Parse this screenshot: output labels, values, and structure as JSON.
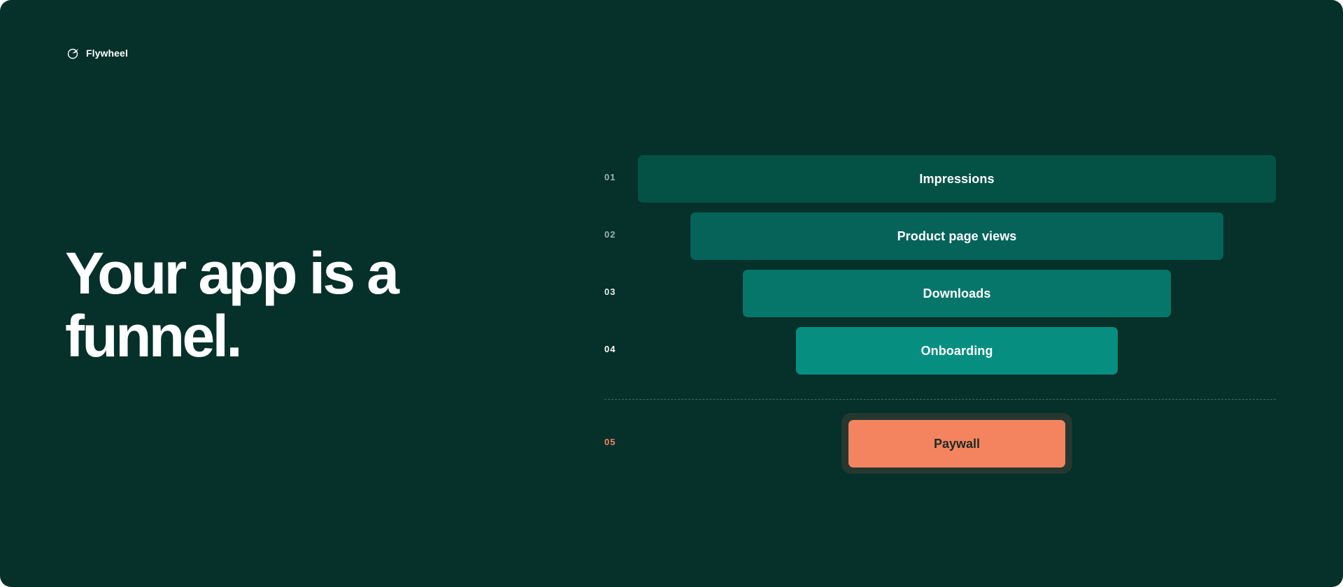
{
  "brand": {
    "name": "Flywheel",
    "icon": "flywheel-logo-icon"
  },
  "headline": {
    "line1": "Your app is a",
    "line2": "funnel."
  },
  "colors": {
    "background": "#06302a",
    "text": "#ffffff",
    "paywall": "#f4845f",
    "paywall_ring": "#25382f"
  },
  "funnel": {
    "steps": [
      {
        "number": "01",
        "label": "Impressions",
        "color": "#045246",
        "number_color": "#9bb5ae"
      },
      {
        "number": "02",
        "label": "Product page views",
        "color": "#05635a",
        "number_color": "#9bb5ae"
      },
      {
        "number": "03",
        "label": "Downloads",
        "color": "#07766a",
        "number_color": "#e6efec"
      },
      {
        "number": "04",
        "label": "Onboarding",
        "color": "#068f80",
        "number_color": "#ffffff"
      }
    ],
    "paywall": {
      "number": "05",
      "label": "Paywall",
      "number_color": "#f4845f"
    }
  }
}
